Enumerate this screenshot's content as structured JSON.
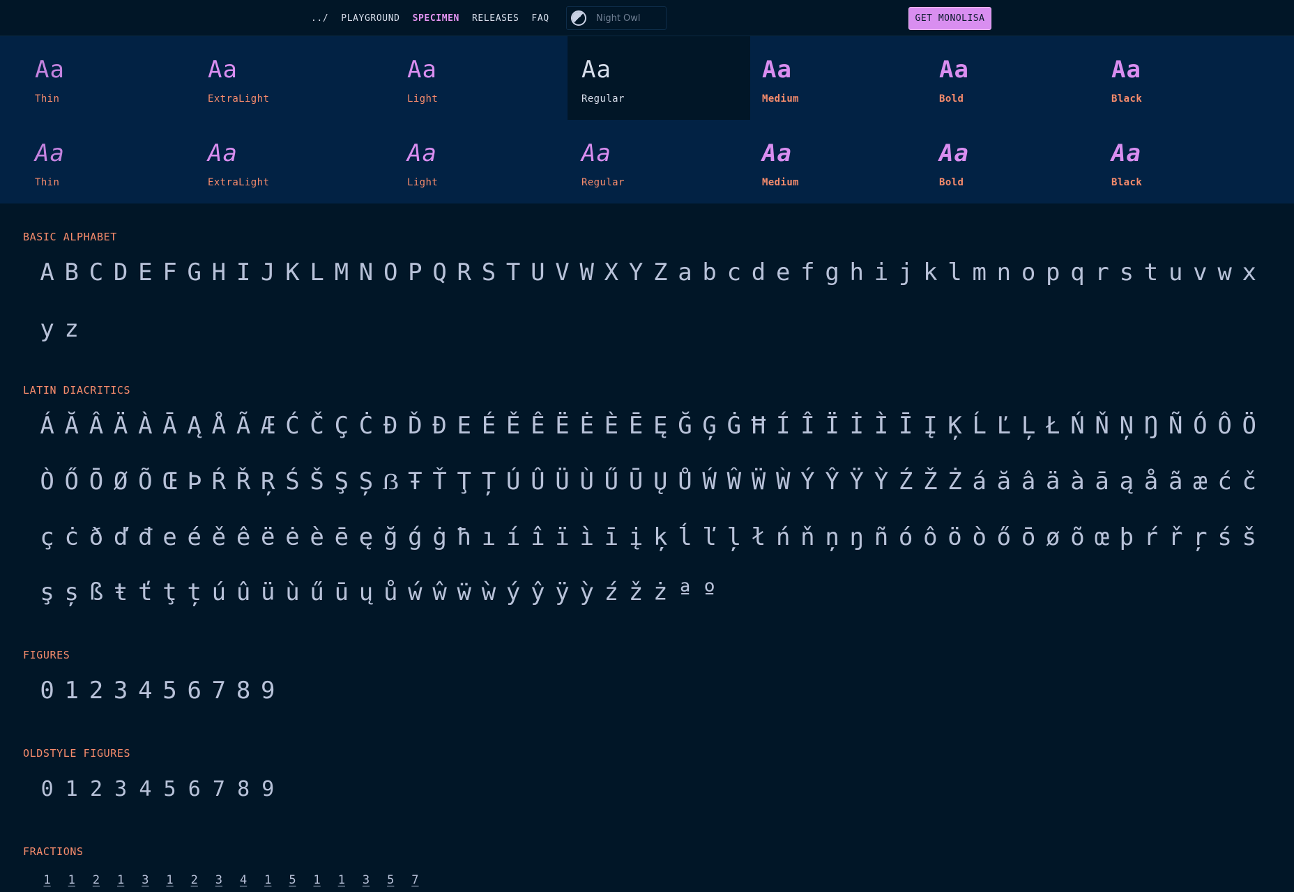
{
  "nav": {
    "links": [
      {
        "label": "../"
      },
      {
        "label": "PLAYGROUND"
      },
      {
        "label": "SPECIMEN",
        "active": true
      },
      {
        "label": "RELEASES"
      },
      {
        "label": "FAQ"
      }
    ],
    "theme": "Night Owl",
    "buy_label": "GET MONOLISA"
  },
  "weights": {
    "sample": "Aa",
    "upright": [
      "Thin",
      "ExtraLight",
      "Light",
      "Regular",
      "Medium",
      "Bold",
      "Black"
    ],
    "italic": [
      "Thin",
      "ExtraLight",
      "Light",
      "Regular",
      "Medium",
      "Bold",
      "Black"
    ],
    "selected": "Regular"
  },
  "sections": {
    "basic": {
      "title": "BASIC ALPHABET",
      "rows": [
        "ABCDEFGHIJKLMNOPQRSTUVWXYZabcdefghijklmnopqrstuvwx",
        "yz"
      ]
    },
    "diacritics": {
      "title": "LATIN DIACRITICS",
      "rows": [
        "ÁĂÂÄÀĀĄÅÃÆĆČÇĊĐĎĐEÉĚÊËĖÈĒĘĞĢĠĦÍÎÏİÌĪĮĶĹĽĻŁŃŇŅŊÑÓÔÖ",
        "ÒŐŌØÕŒÞŔŘŖŚŠŞȘẞŦŤŢȚÚÛÜÙŰŪŲŮẂŴẄẀÝŶŸỲŹŽŻáăâäàāąåãæćč",
        "çċðďđeéěêëėèēęğǵġħıíîïìīįķĺľļłńňņŋñóôöòőōøõœþŕřŗśš",
        "şșßŧťţțúûüùűūųůẃŵẅẁýŷÿỳźžżªº"
      ]
    },
    "figures": {
      "title": "FIGURES",
      "rows": [
        "0123456789"
      ]
    },
    "oldstyle": {
      "title": "OLDSTYLE FIGURES",
      "rows": [
        "0123456789"
      ]
    },
    "fractions": {
      "title": "FRACTIONS",
      "rows": [
        "1121312341511357"
      ]
    }
  }
}
